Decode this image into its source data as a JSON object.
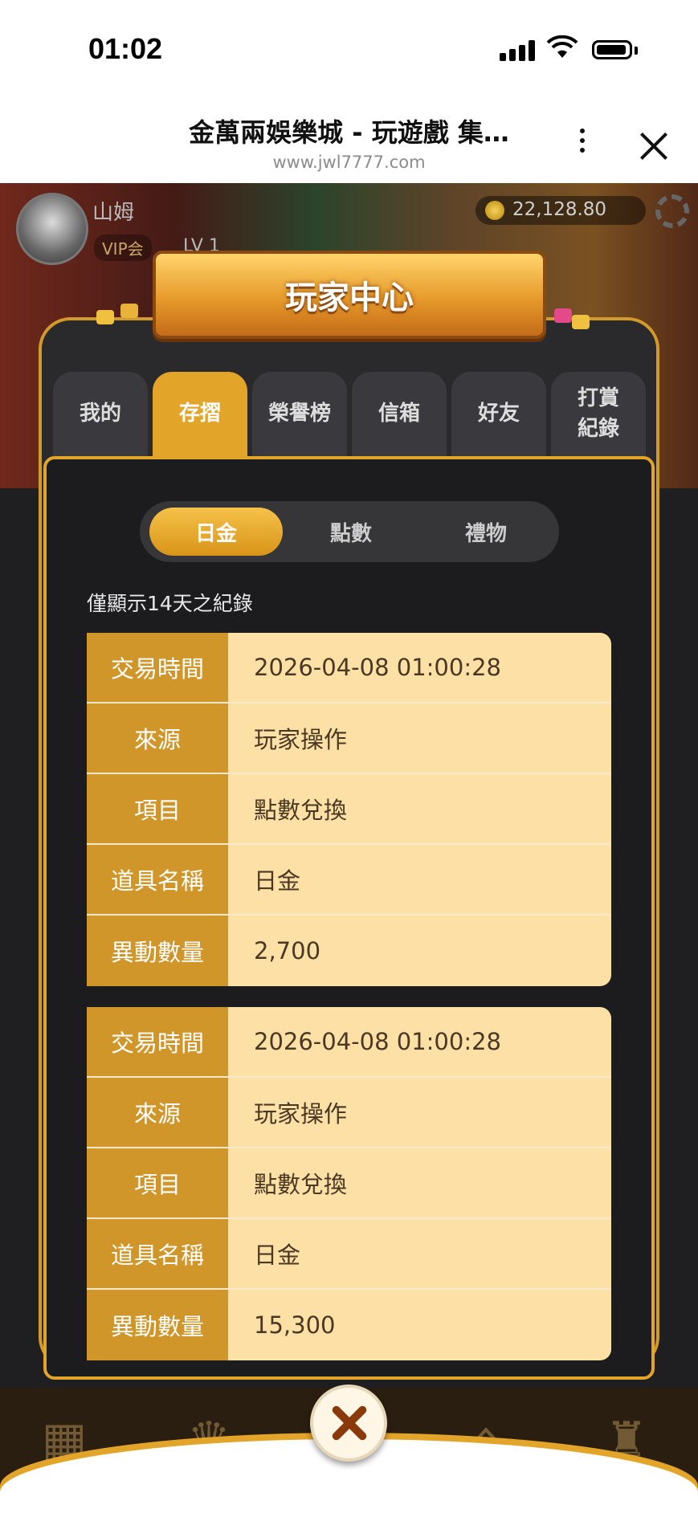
{
  "status": {
    "time": "01:02"
  },
  "browser": {
    "title": "金萬兩娛樂城 - 玩遊戲 集…",
    "url": "www.jwl7777.com"
  },
  "player": {
    "name": "山姆",
    "vip": "VIP会",
    "level": "LV 1",
    "coins": "22,128.80"
  },
  "panel": {
    "title": "玩家中心",
    "tabs": [
      {
        "label": "我的"
      },
      {
        "label": "存摺"
      },
      {
        "label": "榮譽榜"
      },
      {
        "label": "信箱"
      },
      {
        "label": "好友"
      },
      {
        "label": "打賞\n紀錄"
      }
    ],
    "active_tab": "存摺",
    "segments": [
      {
        "label": "日金"
      },
      {
        "label": "點數"
      },
      {
        "label": "禮物"
      }
    ],
    "active_segment": "日金",
    "note": "僅顯示14天之紀錄",
    "field_labels": {
      "time": "交易時間",
      "source": "來源",
      "item": "項目",
      "prop_name": "道具名稱",
      "amount": "異動數量"
    },
    "records": [
      {
        "time": "2026-04-08 01:00:28",
        "source": "玩家操作",
        "item": "點數兌換",
        "prop_name": "日金",
        "amount": "2,700"
      },
      {
        "time": "2026-04-08 01:00:28",
        "source": "玩家操作",
        "item": "點數兌換",
        "prop_name": "日金",
        "amount": "15,300"
      }
    ]
  }
}
